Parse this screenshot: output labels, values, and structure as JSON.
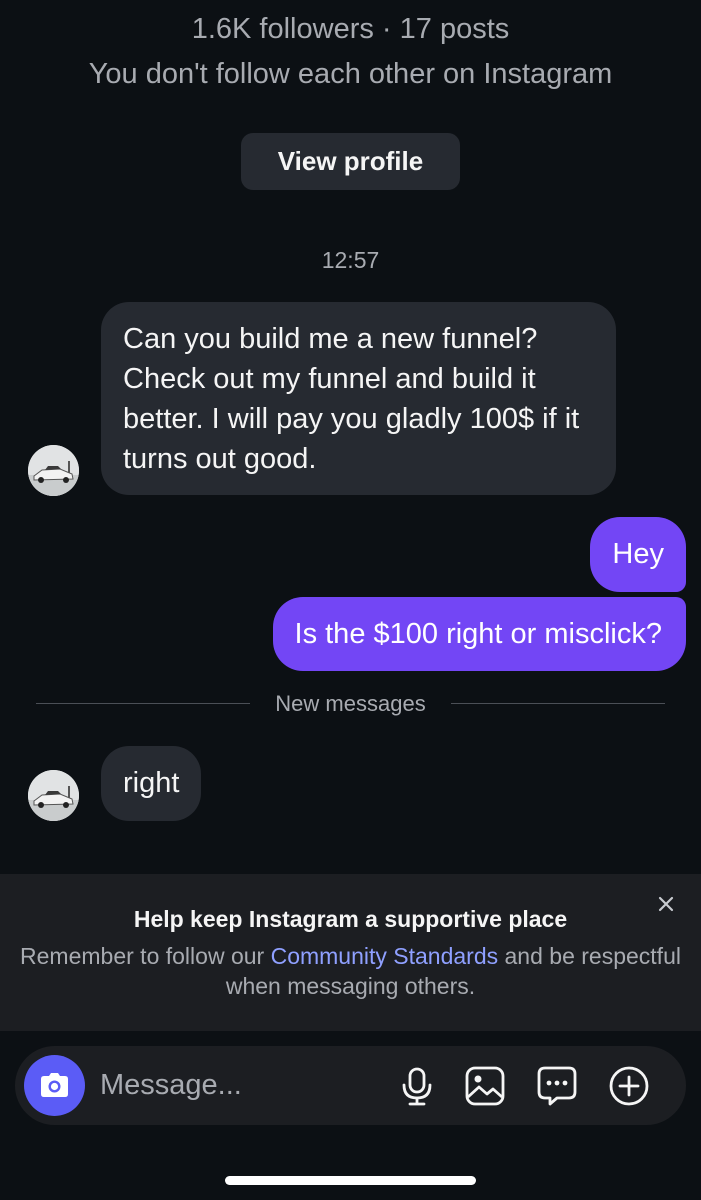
{
  "profile_summary": {
    "followers_line": "1.6K followers · 17 posts",
    "follow_status": "You don't follow each other on Instagram",
    "view_profile_label": "View profile"
  },
  "thread": {
    "timestamp": "12:57",
    "incoming_1": "Can you build me a new funnel? Check out my funnel and build it better. I will pay you gladly 100$ if it turns out good.",
    "outgoing_1": "Hey",
    "outgoing_2": "Is the $100 right or misclick?",
    "new_messages_label": "New messages",
    "incoming_2": "right"
  },
  "notice": {
    "title": "Help keep Instagram a supportive place",
    "body_before": "Remember to follow our ",
    "link_text": "Community Standards",
    "body_after": " and be respectful when messaging others.",
    "close_icon": "close-icon"
  },
  "composer": {
    "placeholder": "Message...",
    "icons": [
      "camera-icon",
      "microphone-icon",
      "image-icon",
      "sticker-icon",
      "plus-circle-icon"
    ]
  },
  "colors": {
    "background": "#0c1014",
    "incoming_bubble": "#262a31",
    "outgoing_bubble": "#7346f5",
    "camera_button": "#5b5cf6",
    "link": "#8fa0ff"
  }
}
